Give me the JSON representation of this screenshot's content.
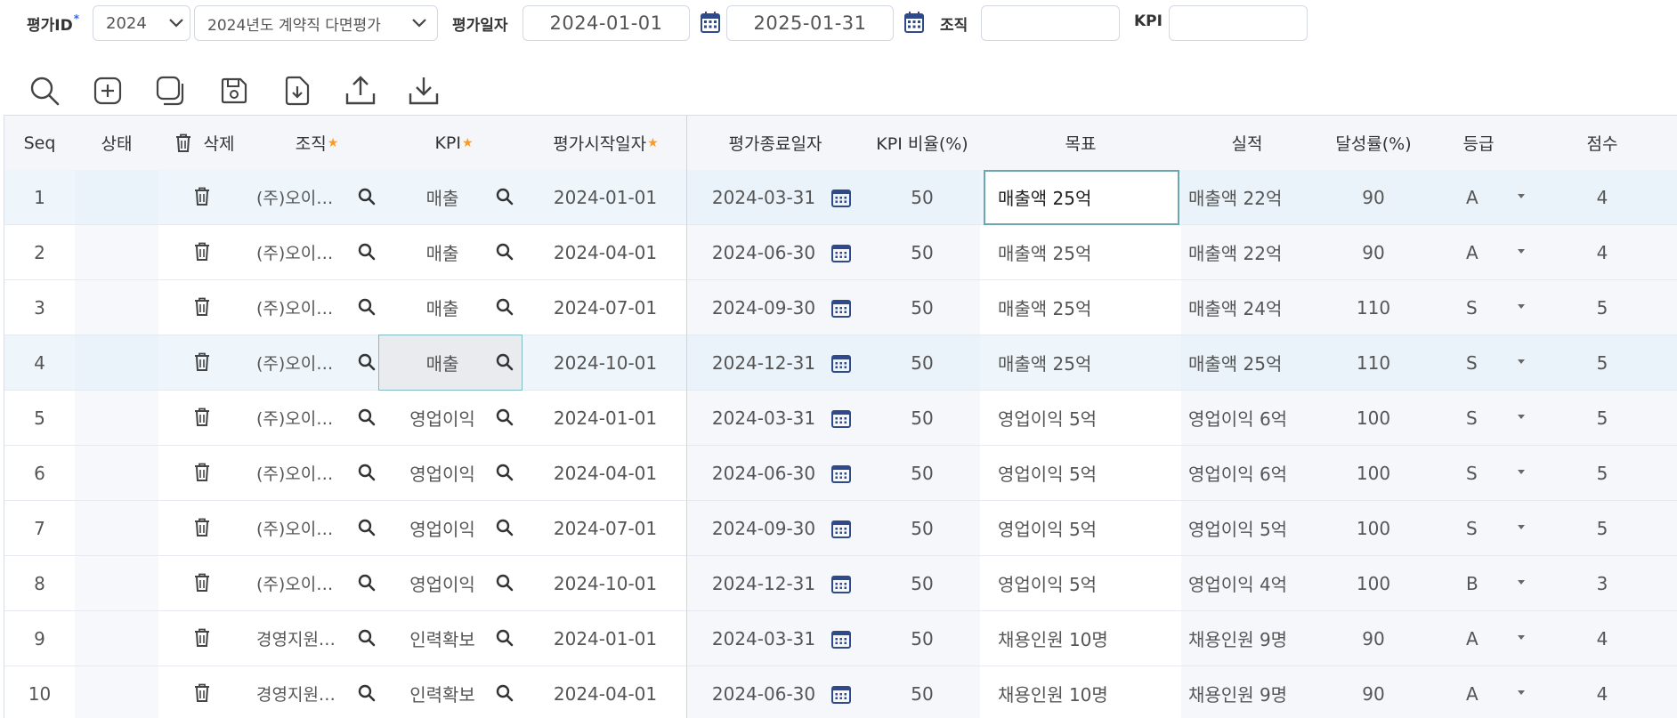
{
  "filters": {
    "eval_id_label": "평가ID",
    "required_mark": "*",
    "year_value": "2024",
    "eval_name_value": "2024년도 계약직 다면평가",
    "eval_date_label": "평가일자",
    "date_from": "2024-01-01",
    "date_to": "2025-01-31",
    "org_label": "조직",
    "org_value": "",
    "kpi_label": "KPI",
    "kpi_value": ""
  },
  "toolbar": {
    "icons": [
      "search-icon",
      "add-icon",
      "copy-icon",
      "save-icon",
      "import-icon",
      "upload-icon",
      "download-icon"
    ]
  },
  "grid": {
    "headers": {
      "seq": "Seq",
      "status": "상태",
      "delete": "삭제",
      "org": "조직",
      "kpi": "KPI",
      "start_date": "평가시작일자",
      "end_date": "평가종료일자",
      "kpi_ratio": "KPI 비율(%)",
      "goal": "목표",
      "result": "실적",
      "achieve": "달성률(%)",
      "grade": "등급",
      "score": "점수"
    },
    "required_star": "★",
    "rows": [
      {
        "seq": "1",
        "org": "(주)오이…",
        "kpi": "매출",
        "start": "2024-01-01",
        "end": "2024-03-31",
        "ratio": "50",
        "goal": "매출액 25억",
        "result": "매출액 22억",
        "achieve": "90",
        "grade": "A",
        "score": "4"
      },
      {
        "seq": "2",
        "org": "(주)오이…",
        "kpi": "매출",
        "start": "2024-04-01",
        "end": "2024-06-30",
        "ratio": "50",
        "goal": "매출액 25억",
        "result": "매출액 22억",
        "achieve": "90",
        "grade": "A",
        "score": "4"
      },
      {
        "seq": "3",
        "org": "(주)오이…",
        "kpi": "매출",
        "start": "2024-07-01",
        "end": "2024-09-30",
        "ratio": "50",
        "goal": "매출액 25억",
        "result": "매출액 24억",
        "achieve": "110",
        "grade": "S",
        "score": "5"
      },
      {
        "seq": "4",
        "org": "(주)오이…",
        "kpi": "매출",
        "start": "2024-10-01",
        "end": "2024-12-31",
        "ratio": "50",
        "goal": "매출액 25억",
        "result": "매출액 25억",
        "achieve": "110",
        "grade": "S",
        "score": "5"
      },
      {
        "seq": "5",
        "org": "(주)오이…",
        "kpi": "영업이익",
        "start": "2024-01-01",
        "end": "2024-03-31",
        "ratio": "50",
        "goal": "영업이익 5억",
        "result": "영업이익 6억",
        "achieve": "100",
        "grade": "S",
        "score": "5"
      },
      {
        "seq": "6",
        "org": "(주)오이…",
        "kpi": "영업이익",
        "start": "2024-04-01",
        "end": "2024-06-30",
        "ratio": "50",
        "goal": "영업이익 5억",
        "result": "영업이익 6억",
        "achieve": "100",
        "grade": "S",
        "score": "5"
      },
      {
        "seq": "7",
        "org": "(주)오이…",
        "kpi": "영업이익",
        "start": "2024-07-01",
        "end": "2024-09-30",
        "ratio": "50",
        "goal": "영업이익 5억",
        "result": "영업이익 5억",
        "achieve": "100",
        "grade": "S",
        "score": "5"
      },
      {
        "seq": "8",
        "org": "(주)오이…",
        "kpi": "영업이익",
        "start": "2024-10-01",
        "end": "2024-12-31",
        "ratio": "50",
        "goal": "영업이익 5억",
        "result": "영업이익 4억",
        "achieve": "100",
        "grade": "B",
        "score": "3"
      },
      {
        "seq": "9",
        "org": "경영지원…",
        "kpi": "인력확보",
        "start": "2024-01-01",
        "end": "2024-03-31",
        "ratio": "50",
        "goal": "채용인원 10명",
        "result": "채용인원 9명",
        "achieve": "90",
        "grade": "A",
        "score": "4"
      },
      {
        "seq": "10",
        "org": "경영지원…",
        "kpi": "인력확보",
        "start": "2024-04-01",
        "end": "2024-06-30",
        "ratio": "50",
        "goal": "채용인원 10명",
        "result": "채용인원 9명",
        "achieve": "90",
        "grade": "A",
        "score": "4"
      }
    ]
  },
  "colors": {
    "required": "#2a61ff",
    "star": "#ff9a1f",
    "focus_border": "#6ba7b2",
    "selected_row": "#eef6fb"
  }
}
